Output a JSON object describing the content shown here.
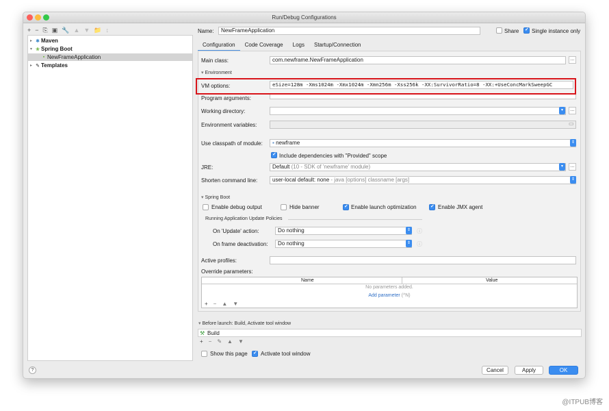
{
  "window": {
    "title": "Run/Debug Configurations"
  },
  "tree": {
    "items": [
      {
        "label": "Maven",
        "arrow": "▸",
        "icon": "✱"
      },
      {
        "label": "Spring Boot",
        "arrow": "▾",
        "icon": "❀"
      },
      {
        "label": "NewFrameApplication",
        "arrow": "",
        "icon": "▪"
      },
      {
        "label": "Templates",
        "arrow": "▸",
        "icon": "🔧"
      }
    ]
  },
  "toolbar": {
    "icons": [
      "+",
      "−",
      "⎘",
      "▣",
      "🔧",
      "▲",
      "▼",
      "📁",
      "↕"
    ]
  },
  "name": {
    "label": "Name:",
    "value": "NewFrameApplication",
    "share": "Share",
    "single": "Single instance only"
  },
  "tabs": [
    "Configuration",
    "Code Coverage",
    "Logs",
    "Startup/Connection"
  ],
  "config": {
    "main_class_label": "Main class:",
    "main_class": "com.newframe.NewFrameApplication",
    "env_section": "Environment",
    "vm_label": "VM options:",
    "vm_value": "eSize=128m -Xms1024m -Xmx1024m -Xmn256m -Xss256k -XX:SurvivorRatio=8 -XX:+UseConcMarkSweepGC",
    "prog_label": "Program arguments:",
    "workdir_label": "Working directory:",
    "envvars_label": "Environment variables:",
    "classpath_label": "Use classpath of module:",
    "classpath_value": "newframe",
    "include_deps": "Include dependencies with \"Provided\" scope",
    "jre_label": "JRE:",
    "jre_value": "Default",
    "jre_detail": "(10 - SDK of 'newframe' module)",
    "shorten_label": "Shorten command line:",
    "shorten_value": "user-local default: none",
    "shorten_detail": "- java [options] classname [args]"
  },
  "spring": {
    "section": "Spring Boot",
    "debug": "Enable debug output",
    "hide": "Hide banner",
    "launch": "Enable launch optimization",
    "jmx": "Enable JMX agent",
    "policies": "Running Application Update Policies",
    "update_label": "On 'Update' action:",
    "update_value": "Do nothing",
    "frame_label": "On frame deactivation:",
    "frame_value": "Do nothing"
  },
  "profiles": {
    "label": "Active profiles:",
    "override": "Override parameters:"
  },
  "table": {
    "col_name": "Name",
    "col_value": "Value",
    "empty": "No parameters added.",
    "add": "Add parameter",
    "shortcut": "(^N)"
  },
  "before": {
    "section": "Before launch: Build, Activate tool window",
    "item": "Build"
  },
  "bottom": {
    "show_page": "Show this page",
    "activate": "Activate tool window"
  },
  "buttons": {
    "cancel": "Cancel",
    "apply": "Apply",
    "ok": "OK",
    "help": "?"
  },
  "watermark": "@ITPUB博客"
}
